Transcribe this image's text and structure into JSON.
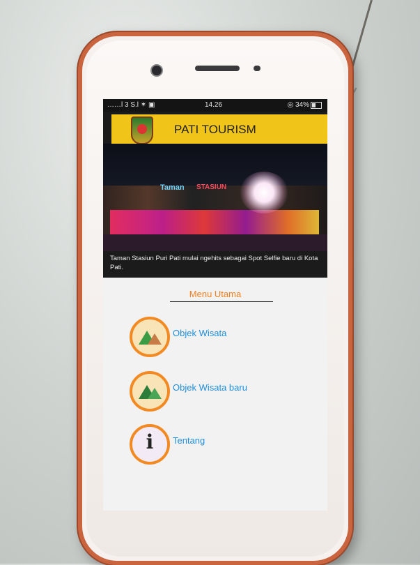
{
  "status_bar": {
    "left": "……l 3 S.l ✶ ▣",
    "time": "14.26",
    "right": "◎ 34%"
  },
  "app_bar": {
    "title": "PATI TOURISM",
    "logo_icon": "regency-crest-icon",
    "background_color": "#f0c419"
  },
  "banner": {
    "sign_part1": "Taman",
    "sign_part2": "STASIUN",
    "caption": "Taman Stasiun Puri Pati mulai ngehits sebagai Spot Selfie baru di Kota Pati."
  },
  "menu": {
    "title": "Menu Utama",
    "accent_color": "#f07f1e",
    "label_color": "#1f8fdc",
    "items": [
      {
        "label": "Objek Wisata",
        "icon": "landscape-icon"
      },
      {
        "label": "Objek Wisata baru",
        "icon": "mountain-icon"
      },
      {
        "label": "Tentang",
        "icon": "info-icon"
      }
    ]
  }
}
